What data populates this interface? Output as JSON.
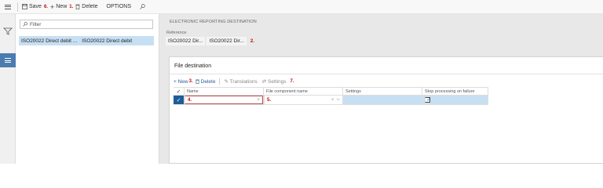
{
  "toolbar": {
    "save_label": "Save",
    "save_marker": "6.",
    "new_label": "New",
    "new_marker": "1.",
    "delete_label": "Delete",
    "options_label": "OPTIONS"
  },
  "list": {
    "filter_placeholder": "Filter",
    "rows": [
      {
        "col1": "ISO20022 Direct debit ...",
        "col2": "ISO20022 Direct debit"
      }
    ]
  },
  "main": {
    "heading": "ELECTRONIC REPORTING DESTINATION",
    "reference_label": "Reference",
    "reference_values": [
      "ISO20022 Dir...",
      "ISO20022 Dir..."
    ],
    "reference_marker": "2."
  },
  "file_destination": {
    "title": "File destination",
    "new_label": "New",
    "new_marker": "3.",
    "delete_label": "Delete",
    "translations_label": "Translations",
    "settings_label": "Settings",
    "settings_marker": "7.",
    "columns": [
      "Name",
      "File component name",
      "Settings",
      "Stop processing on failure"
    ],
    "row": {
      "name_marker": "4.",
      "component_marker": "5.",
      "stop_processing": true
    }
  },
  "colors": {
    "accent": "#1f5c99",
    "selection": "#c7dff2",
    "marker": "#d00000"
  }
}
